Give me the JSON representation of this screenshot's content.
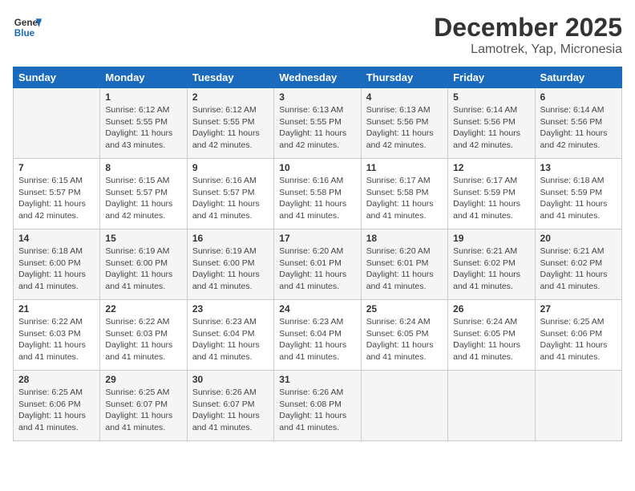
{
  "header": {
    "logo_general": "General",
    "logo_blue": "Blue",
    "month": "December 2025",
    "location": "Lamotrek, Yap, Micronesia"
  },
  "days_of_week": [
    "Sunday",
    "Monday",
    "Tuesday",
    "Wednesday",
    "Thursday",
    "Friday",
    "Saturday"
  ],
  "weeks": [
    [
      {
        "day": "",
        "info": ""
      },
      {
        "day": "1",
        "info": "Sunrise: 6:12 AM\nSunset: 5:55 PM\nDaylight: 11 hours\nand 43 minutes."
      },
      {
        "day": "2",
        "info": "Sunrise: 6:12 AM\nSunset: 5:55 PM\nDaylight: 11 hours\nand 42 minutes."
      },
      {
        "day": "3",
        "info": "Sunrise: 6:13 AM\nSunset: 5:55 PM\nDaylight: 11 hours\nand 42 minutes."
      },
      {
        "day": "4",
        "info": "Sunrise: 6:13 AM\nSunset: 5:56 PM\nDaylight: 11 hours\nand 42 minutes."
      },
      {
        "day": "5",
        "info": "Sunrise: 6:14 AM\nSunset: 5:56 PM\nDaylight: 11 hours\nand 42 minutes."
      },
      {
        "day": "6",
        "info": "Sunrise: 6:14 AM\nSunset: 5:56 PM\nDaylight: 11 hours\nand 42 minutes."
      }
    ],
    [
      {
        "day": "7",
        "info": "Sunrise: 6:15 AM\nSunset: 5:57 PM\nDaylight: 11 hours\nand 42 minutes."
      },
      {
        "day": "8",
        "info": "Sunrise: 6:15 AM\nSunset: 5:57 PM\nDaylight: 11 hours\nand 42 minutes."
      },
      {
        "day": "9",
        "info": "Sunrise: 6:16 AM\nSunset: 5:57 PM\nDaylight: 11 hours\nand 41 minutes."
      },
      {
        "day": "10",
        "info": "Sunrise: 6:16 AM\nSunset: 5:58 PM\nDaylight: 11 hours\nand 41 minutes."
      },
      {
        "day": "11",
        "info": "Sunrise: 6:17 AM\nSunset: 5:58 PM\nDaylight: 11 hours\nand 41 minutes."
      },
      {
        "day": "12",
        "info": "Sunrise: 6:17 AM\nSunset: 5:59 PM\nDaylight: 11 hours\nand 41 minutes."
      },
      {
        "day": "13",
        "info": "Sunrise: 6:18 AM\nSunset: 5:59 PM\nDaylight: 11 hours\nand 41 minutes."
      }
    ],
    [
      {
        "day": "14",
        "info": "Sunrise: 6:18 AM\nSunset: 6:00 PM\nDaylight: 11 hours\nand 41 minutes."
      },
      {
        "day": "15",
        "info": "Sunrise: 6:19 AM\nSunset: 6:00 PM\nDaylight: 11 hours\nand 41 minutes."
      },
      {
        "day": "16",
        "info": "Sunrise: 6:19 AM\nSunset: 6:00 PM\nDaylight: 11 hours\nand 41 minutes."
      },
      {
        "day": "17",
        "info": "Sunrise: 6:20 AM\nSunset: 6:01 PM\nDaylight: 11 hours\nand 41 minutes."
      },
      {
        "day": "18",
        "info": "Sunrise: 6:20 AM\nSunset: 6:01 PM\nDaylight: 11 hours\nand 41 minutes."
      },
      {
        "day": "19",
        "info": "Sunrise: 6:21 AM\nSunset: 6:02 PM\nDaylight: 11 hours\nand 41 minutes."
      },
      {
        "day": "20",
        "info": "Sunrise: 6:21 AM\nSunset: 6:02 PM\nDaylight: 11 hours\nand 41 minutes."
      }
    ],
    [
      {
        "day": "21",
        "info": "Sunrise: 6:22 AM\nSunset: 6:03 PM\nDaylight: 11 hours\nand 41 minutes."
      },
      {
        "day": "22",
        "info": "Sunrise: 6:22 AM\nSunset: 6:03 PM\nDaylight: 11 hours\nand 41 minutes."
      },
      {
        "day": "23",
        "info": "Sunrise: 6:23 AM\nSunset: 6:04 PM\nDaylight: 11 hours\nand 41 minutes."
      },
      {
        "day": "24",
        "info": "Sunrise: 6:23 AM\nSunset: 6:04 PM\nDaylight: 11 hours\nand 41 minutes."
      },
      {
        "day": "25",
        "info": "Sunrise: 6:24 AM\nSunset: 6:05 PM\nDaylight: 11 hours\nand 41 minutes."
      },
      {
        "day": "26",
        "info": "Sunrise: 6:24 AM\nSunset: 6:05 PM\nDaylight: 11 hours\nand 41 minutes."
      },
      {
        "day": "27",
        "info": "Sunrise: 6:25 AM\nSunset: 6:06 PM\nDaylight: 11 hours\nand 41 minutes."
      }
    ],
    [
      {
        "day": "28",
        "info": "Sunrise: 6:25 AM\nSunset: 6:06 PM\nDaylight: 11 hours\nand 41 minutes."
      },
      {
        "day": "29",
        "info": "Sunrise: 6:25 AM\nSunset: 6:07 PM\nDaylight: 11 hours\nand 41 minutes."
      },
      {
        "day": "30",
        "info": "Sunrise: 6:26 AM\nSunset: 6:07 PM\nDaylight: 11 hours\nand 41 minutes."
      },
      {
        "day": "31",
        "info": "Sunrise: 6:26 AM\nSunset: 6:08 PM\nDaylight: 11 hours\nand 41 minutes."
      },
      {
        "day": "",
        "info": ""
      },
      {
        "day": "",
        "info": ""
      },
      {
        "day": "",
        "info": ""
      }
    ]
  ]
}
